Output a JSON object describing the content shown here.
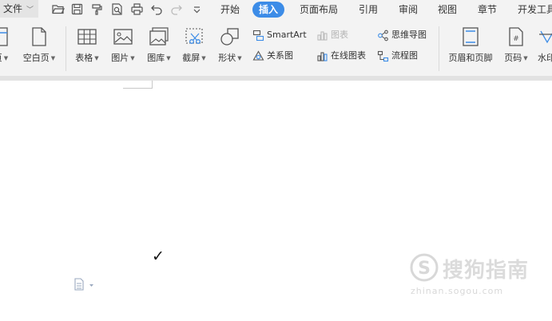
{
  "menubar": {
    "file_label": "文件",
    "tabs": [
      {
        "label": "开始"
      },
      {
        "label": "插入"
      },
      {
        "label": "页面布局"
      },
      {
        "label": "引用"
      },
      {
        "label": "审阅"
      },
      {
        "label": "视图"
      },
      {
        "label": "章节"
      },
      {
        "label": "开发工具"
      }
    ],
    "active_tab": "插入",
    "accent_color": "#3c8ce7"
  },
  "ribbon": {
    "cover_page": "页",
    "blank_page": "空白页",
    "table": "表格",
    "picture": "图片",
    "gallery": "图库",
    "screenshot": "截屏",
    "shape": "形状",
    "smartart": "SmartArt",
    "chart": "图表",
    "relation": "关系图",
    "online_chart": "在线图表",
    "mindmap": "思维导图",
    "flowchart": "流程图",
    "header_footer": "页眉和页脚",
    "page_number": "页码",
    "watermark": "水印"
  },
  "document": {
    "checkmark": "✓"
  },
  "watermark": {
    "text": "搜狗指南",
    "url": "zhinan.sogou.com"
  }
}
